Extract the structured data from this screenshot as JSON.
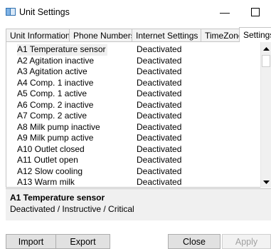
{
  "window": {
    "title": "Unit Settings",
    "minimize_glyph": "—",
    "app_icon": "unit-icon"
  },
  "tabs": [
    {
      "label": "Unit Information"
    },
    {
      "label": "Phone Numbers"
    },
    {
      "label": "Internet Settings"
    },
    {
      "label": "TimeZone"
    },
    {
      "label": "Settings",
      "active": true
    }
  ],
  "list": {
    "selected_index": 0,
    "rows": [
      {
        "name": "A1 Temperature sensor",
        "status": "Deactivated"
      },
      {
        "name": "A2 Agitation inactive",
        "status": "Deactivated"
      },
      {
        "name": "A3 Agitation active",
        "status": "Deactivated"
      },
      {
        "name": "A4 Comp. 1 inactive",
        "status": "Deactivated"
      },
      {
        "name": "A5 Comp. 1 active",
        "status": "Deactivated"
      },
      {
        "name": "A6 Comp. 2 inactive",
        "status": "Deactivated"
      },
      {
        "name": "A7 Comp. 2 active",
        "status": "Deactivated"
      },
      {
        "name": "A8 Milk pump inactive",
        "status": "Deactivated"
      },
      {
        "name": "A9 Milk pump active",
        "status": "Deactivated"
      },
      {
        "name": "A10 Outlet closed",
        "status": "Deactivated"
      },
      {
        "name": "A11 Outlet open",
        "status": "Deactivated"
      },
      {
        "name": "A12 Slow cooling",
        "status": "Deactivated"
      },
      {
        "name": "A13 Warm milk",
        "status": "Deactivated"
      }
    ]
  },
  "detail": {
    "title": "A1 Temperature sensor",
    "text": "Deactivated / Instructive / Critical"
  },
  "buttons": {
    "import": "Import",
    "export": "Export",
    "close": "Close",
    "apply": "Apply"
  }
}
